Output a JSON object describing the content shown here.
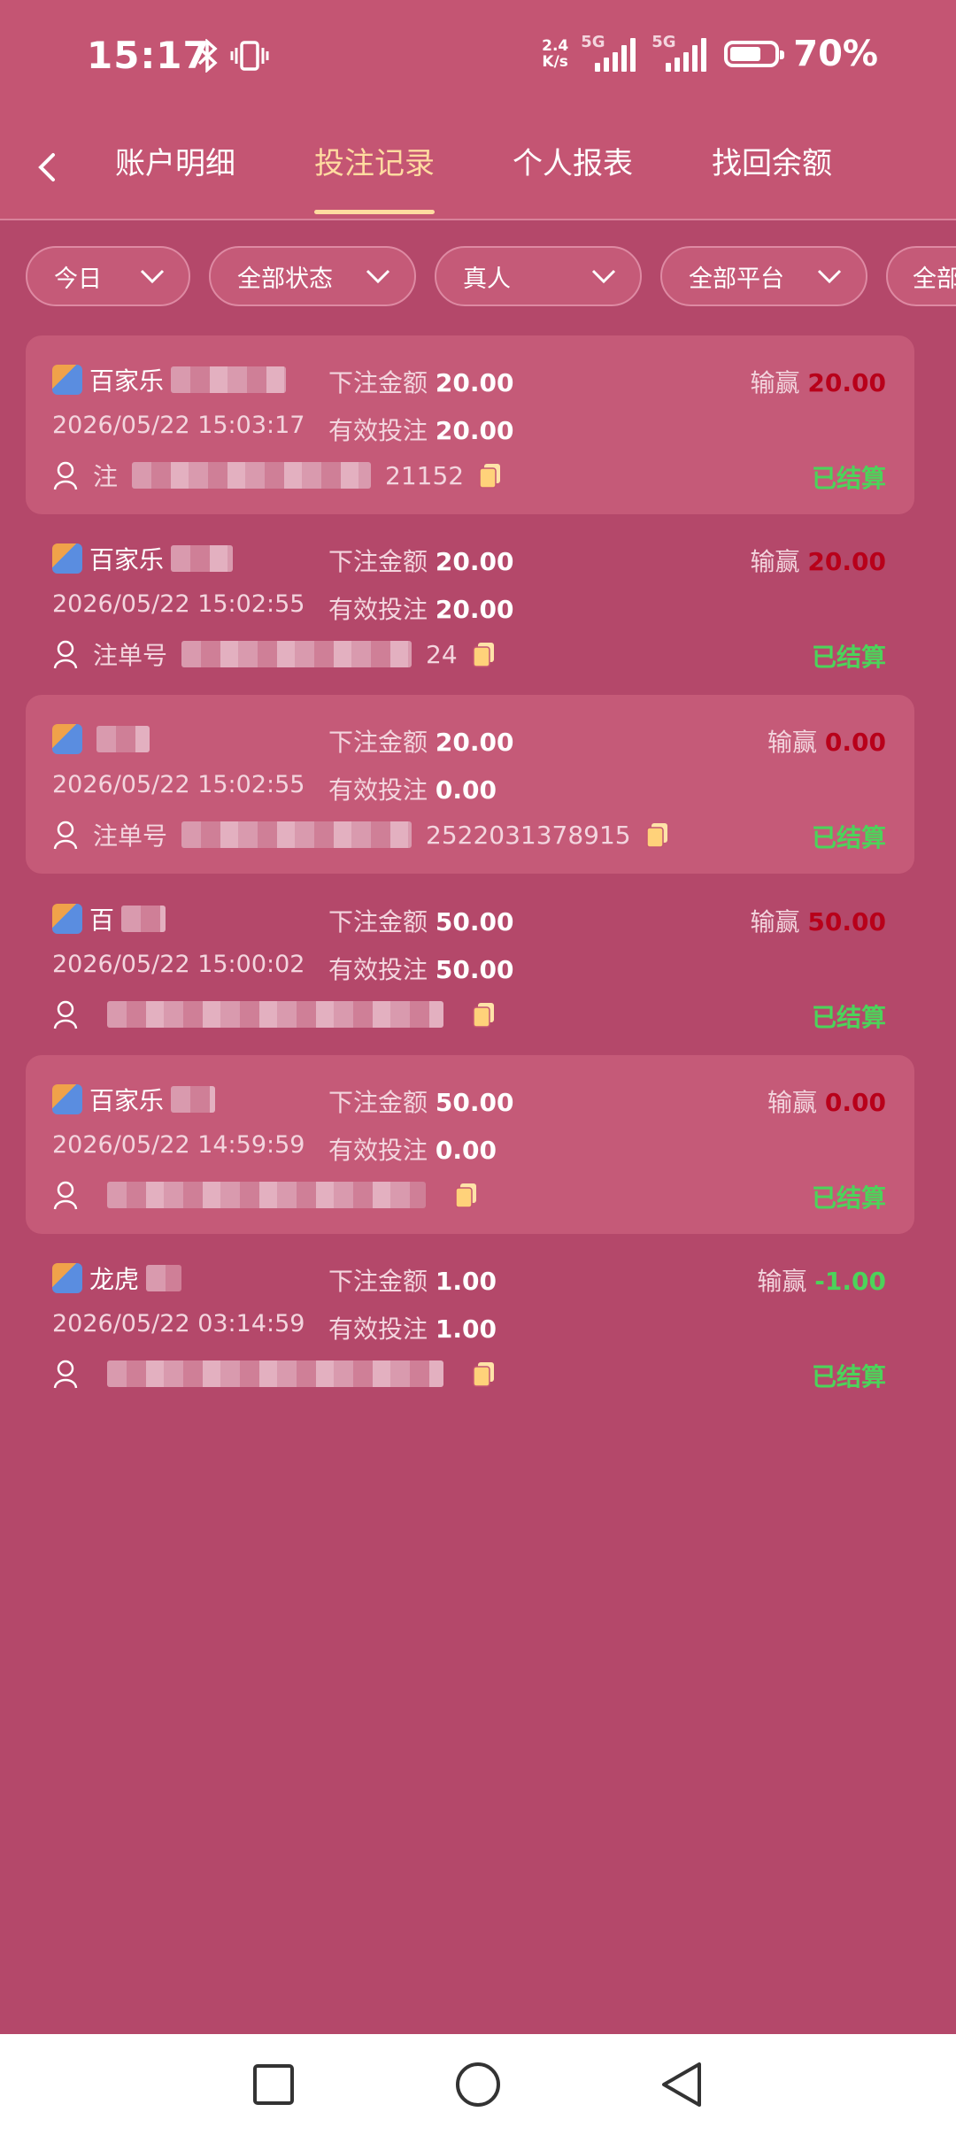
{
  "status_bar": {
    "time": "15:17",
    "net_speed_top": "2.4",
    "net_speed_bottom": "K/s",
    "sig1_label": "5G",
    "sig2_label": "5G",
    "battery_level": 0.7,
    "battery_text": "70%"
  },
  "tabs": [
    {
      "label": "账户明细",
      "active": false
    },
    {
      "label": "投注记录",
      "active": true
    },
    {
      "label": "个人报表",
      "active": false
    },
    {
      "label": "找回余额",
      "active": false
    }
  ],
  "filters": [
    {
      "label": "今日"
    },
    {
      "label": "全部状态"
    },
    {
      "label": "真人"
    },
    {
      "label": "全部平台"
    },
    {
      "label": "全部"
    }
  ],
  "labels": {
    "bet_amount": "下注金额",
    "valid_bet": "有效投注",
    "win_loss": "输赢",
    "order_no": "注单号"
  },
  "records": [
    {
      "game": "百家乐",
      "amount": "20.00",
      "valid": "20.00",
      "winloss": "20.00",
      "winloss_color": "red",
      "time": "2026/05/22 15:03:17",
      "order_prefix": "注",
      "order_suffix": "21152",
      "status": "已结算"
    },
    {
      "game": "百家乐",
      "amount": "20.00",
      "valid": "20.00",
      "winloss": "20.00",
      "winloss_color": "red",
      "time": "2026/05/22 15:02:55",
      "order_prefix": "注单号",
      "order_suffix": "24",
      "status": "已结算"
    },
    {
      "game": "",
      "amount": "20.00",
      "valid": "0.00",
      "winloss": "0.00",
      "winloss_color": "red",
      "time": "2026/05/22 15:02:55",
      "order_prefix": "注单号",
      "order_suffix": "2522031378915",
      "status": "已结算"
    },
    {
      "game": "百",
      "amount": "50.00",
      "valid": "50.00",
      "winloss": "50.00",
      "winloss_color": "red",
      "time": "2026/05/22 15:00:02",
      "order_prefix": "",
      "order_suffix": "",
      "status": "已结算"
    },
    {
      "game": "百家乐",
      "amount": "50.00",
      "valid": "0.00",
      "winloss": "0.00",
      "winloss_color": "red",
      "time": "2026/05/22 14:59:59",
      "order_prefix": "",
      "order_suffix": "",
      "status": "已结算"
    },
    {
      "game": "龙虎",
      "amount": "1.00",
      "valid": "1.00",
      "winloss": "-1.00",
      "winloss_color": "green",
      "time": "2026/05/22 03:14:59",
      "order_prefix": "",
      "order_suffix": "",
      "status": "已结算"
    }
  ],
  "colors": {
    "background": "#b4486a",
    "header": "#c45573",
    "active_tab": "#ffdba0",
    "win": "#b8001a",
    "loss": "#4cd35a",
    "settled": "#4cd35a"
  }
}
